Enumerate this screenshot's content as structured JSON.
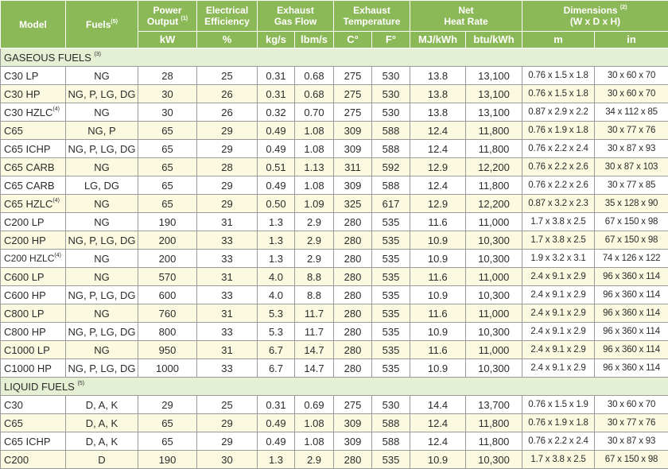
{
  "header": {
    "model": "Model",
    "fuels": "Fuels",
    "fuels_note": "(5)",
    "power_line1": "Power",
    "power_line2": "Output",
    "power_note": "(1)",
    "eff_line1": "Electrical",
    "eff_line2": "Efficiency",
    "exhaust_flow_line1": "Exhaust",
    "exhaust_flow_line2": "Gas Flow",
    "exhaust_temp_line1": "Exhaust",
    "exhaust_temp_line2": "Temperature",
    "heat_rate_line1": "Net",
    "heat_rate_line2": "Heat Rate",
    "dim_line1": "Dimensions",
    "dim_note": "(2)",
    "dim_line2": "(W x D x H)",
    "units": [
      "kW",
      "%",
      "kg/s",
      "lbm/s",
      "C°",
      "F°",
      "MJ/kWh",
      "btu/kWh",
      "m",
      "in"
    ]
  },
  "sections": [
    {
      "title": "GASEOUS FUELS",
      "note": "(3)",
      "rows": [
        {
          "model": "C30 LP",
          "note": "",
          "fuels": "NG",
          "kw": "28",
          "eff": "25",
          "kgs": "0.31",
          "lbms": "0.68",
          "c": "275",
          "f": "530",
          "mj": "13.8",
          "btu": "13,100",
          "dim_m": "0.76 x 1.5 x 1.8",
          "dim_in": "30 x 60 x 70"
        },
        {
          "model": "C30 HP",
          "note": "",
          "fuels": "NG, P, LG, DG",
          "kw": "30",
          "eff": "26",
          "kgs": "0.31",
          "lbms": "0.68",
          "c": "275",
          "f": "530",
          "mj": "13.8",
          "btu": "13,100",
          "dim_m": "0.76 x 1.5 x 1.8",
          "dim_in": "30 x 60 x 70"
        },
        {
          "model": "C30 HZLC",
          "note": "(4)",
          "fuels": "NG",
          "kw": "30",
          "eff": "26",
          "kgs": "0.32",
          "lbms": "0.70",
          "c": "275",
          "f": "530",
          "mj": "13.8",
          "btu": "13,100",
          "dim_m": "0.87 x 2.9 x 2.2",
          "dim_in": "34 x 112 x 85"
        },
        {
          "model": "C65",
          "note": "",
          "fuels": "NG, P",
          "kw": "65",
          "eff": "29",
          "kgs": "0.49",
          "lbms": "1.08",
          "c": "309",
          "f": "588",
          "mj": "12.4",
          "btu": "11,800",
          "dim_m": "0.76 x 1.9 x 1.8",
          "dim_in": "30 x 77 x 76"
        },
        {
          "model": "C65 ICHP",
          "note": "",
          "fuels": "NG, P, LG, DG",
          "kw": "65",
          "eff": "29",
          "kgs": "0.49",
          "lbms": "1.08",
          "c": "309",
          "f": "588",
          "mj": "12.4",
          "btu": "11,800",
          "dim_m": "0.76 x 2.2 x 2.4",
          "dim_in": "30 x 87 x 93"
        },
        {
          "model": "C65 CARB",
          "note": "",
          "fuels": "NG",
          "kw": "65",
          "eff": "28",
          "kgs": "0.51",
          "lbms": "1.13",
          "c": "311",
          "f": "592",
          "mj": "12.9",
          "btu": "12,200",
          "dim_m": "0.76 x 2.2 x 2.6",
          "dim_in": "30 x 87 x 103"
        },
        {
          "model": "C65 CARB",
          "note": "",
          "fuels": "LG, DG",
          "kw": "65",
          "eff": "29",
          "kgs": "0.49",
          "lbms": "1.08",
          "c": "309",
          "f": "588",
          "mj": "12.4",
          "btu": "11,800",
          "dim_m": "0.76 x 2.2 x 2.6",
          "dim_in": "30 x 77 x 85"
        },
        {
          "model": "C65 HZLC",
          "note": "(4)",
          "fuels": "NG",
          "kw": "65",
          "eff": "29",
          "kgs": "0.50",
          "lbms": "1.09",
          "c": "325",
          "f": "617",
          "mj": "12.9",
          "btu": "12,200",
          "dim_m": "0.87 x 3.2 x 2.3",
          "dim_in": "35 x 128 x 90"
        },
        {
          "model": "C200 LP",
          "note": "",
          "fuels": "NG",
          "kw": "190",
          "eff": "31",
          "kgs": "1.3",
          "lbms": "2.9",
          "c": "280",
          "f": "535",
          "mj": "11.6",
          "btu": "11,000",
          "dim_m": "1.7 x 3.8 x 2.5",
          "dim_in": "67 x 150 x 98"
        },
        {
          "model": "C200 HP",
          "note": "",
          "fuels": "NG, P, LG, DG",
          "kw": "200",
          "eff": "33",
          "kgs": "1.3",
          "lbms": "2.9",
          "c": "280",
          "f": "535",
          "mj": "10.9",
          "btu": "10,300",
          "dim_m": "1.7 x 3.8 x 2.5",
          "dim_in": "67 x 150 x 98"
        },
        {
          "model": "C200 HZLC",
          "note": "(4)",
          "fuels": "NG",
          "kw": "200",
          "eff": "33",
          "kgs": "1.3",
          "lbms": "2.9",
          "c": "280",
          "f": "535",
          "mj": "10.9",
          "btu": "10,300",
          "dim_m": "1.9 x 3.2 x 3.1",
          "dim_in": "74 x 126 x 122"
        },
        {
          "model": "C600 LP",
          "note": "",
          "fuels": "NG",
          "kw": "570",
          "eff": "31",
          "kgs": "4.0",
          "lbms": "8.8",
          "c": "280",
          "f": "535",
          "mj": "11.6",
          "btu": "11,000",
          "dim_m": "2.4 x 9.1 x 2.9",
          "dim_in": "96 x 360 x 114"
        },
        {
          "model": "C600 HP",
          "note": "",
          "fuels": "NG, P, LG, DG",
          "kw": "600",
          "eff": "33",
          "kgs": "4.0",
          "lbms": "8.8",
          "c": "280",
          "f": "535",
          "mj": "10.9",
          "btu": "10,300",
          "dim_m": "2.4 x 9.1 x 2.9",
          "dim_in": "96 x 360 x 114"
        },
        {
          "model": "C800 LP",
          "note": "",
          "fuels": "NG",
          "kw": "760",
          "eff": "31",
          "kgs": "5.3",
          "lbms": "11.7",
          "c": "280",
          "f": "535",
          "mj": "11.6",
          "btu": "11,000",
          "dim_m": "2.4 x 9.1 x 2.9",
          "dim_in": "96 x 360 x 114"
        },
        {
          "model": "C800 HP",
          "note": "",
          "fuels": "NG, P, LG, DG",
          "kw": "800",
          "eff": "33",
          "kgs": "5.3",
          "lbms": "11.7",
          "c": "280",
          "f": "535",
          "mj": "10.9",
          "btu": "10,300",
          "dim_m": "2.4 x 9.1 x 2.9",
          "dim_in": "96 x 360 x 114"
        },
        {
          "model": "C1000 LP",
          "note": "",
          "fuels": "NG",
          "kw": "950",
          "eff": "31",
          "kgs": "6.7",
          "lbms": "14.7",
          "c": "280",
          "f": "535",
          "mj": "11.6",
          "btu": "11,000",
          "dim_m": "2.4 x 9.1 x 2.9",
          "dim_in": "96 x 360 x 114"
        },
        {
          "model": "C1000 HP",
          "note": "",
          "fuels": "NG, P, LG, DG",
          "kw": "1000",
          "eff": "33",
          "kgs": "6.7",
          "lbms": "14.7",
          "c": "280",
          "f": "535",
          "mj": "10.9",
          "btu": "10,300",
          "dim_m": "2.4 x 9.1 x 2.9",
          "dim_in": "96 x 360 x 114"
        }
      ]
    },
    {
      "title": "LIQUID FUELS",
      "note": "(5)",
      "rows": [
        {
          "model": "C30",
          "note": "",
          "fuels": "D, A, K",
          "kw": "29",
          "eff": "25",
          "kgs": "0.31",
          "lbms": "0.69",
          "c": "275",
          "f": "530",
          "mj": "14.4",
          "btu": "13,700",
          "dim_m": "0.76 x 1.5 x 1.9",
          "dim_in": "30 x 60 x 70"
        },
        {
          "model": "C65",
          "note": "",
          "fuels": "D, A, K",
          "kw": "65",
          "eff": "29",
          "kgs": "0.49",
          "lbms": "1.08",
          "c": "309",
          "f": "588",
          "mj": "12.4",
          "btu": "11,800",
          "dim_m": "0.76 x 1.9 x 1.8",
          "dim_in": "30 x 77 x 76"
        },
        {
          "model": "C65 ICHP",
          "note": "",
          "fuels": "D, A, K",
          "kw": "65",
          "eff": "29",
          "kgs": "0.49",
          "lbms": "1.08",
          "c": "309",
          "f": "588",
          "mj": "12.4",
          "btu": "11,800",
          "dim_m": "0.76 x 2.2 x 2.4",
          "dim_in": "30 x 87 x 93"
        },
        {
          "model": "C200",
          "note": "",
          "fuels": "D",
          "kw": "190",
          "eff": "30",
          "kgs": "1.3",
          "lbms": "2.9",
          "c": "280",
          "f": "535",
          "mj": "10.9",
          "btu": "10,300",
          "dim_m": "1.7 x 3.8 x 2.5",
          "dim_in": "67 x 150 x 98"
        }
      ]
    }
  ],
  "colors": {
    "header_bg": "#8cb957",
    "section_bg": "#e5efd4",
    "row_alt_bg": "#fcf9e1",
    "border": "#9a9a9a"
  }
}
